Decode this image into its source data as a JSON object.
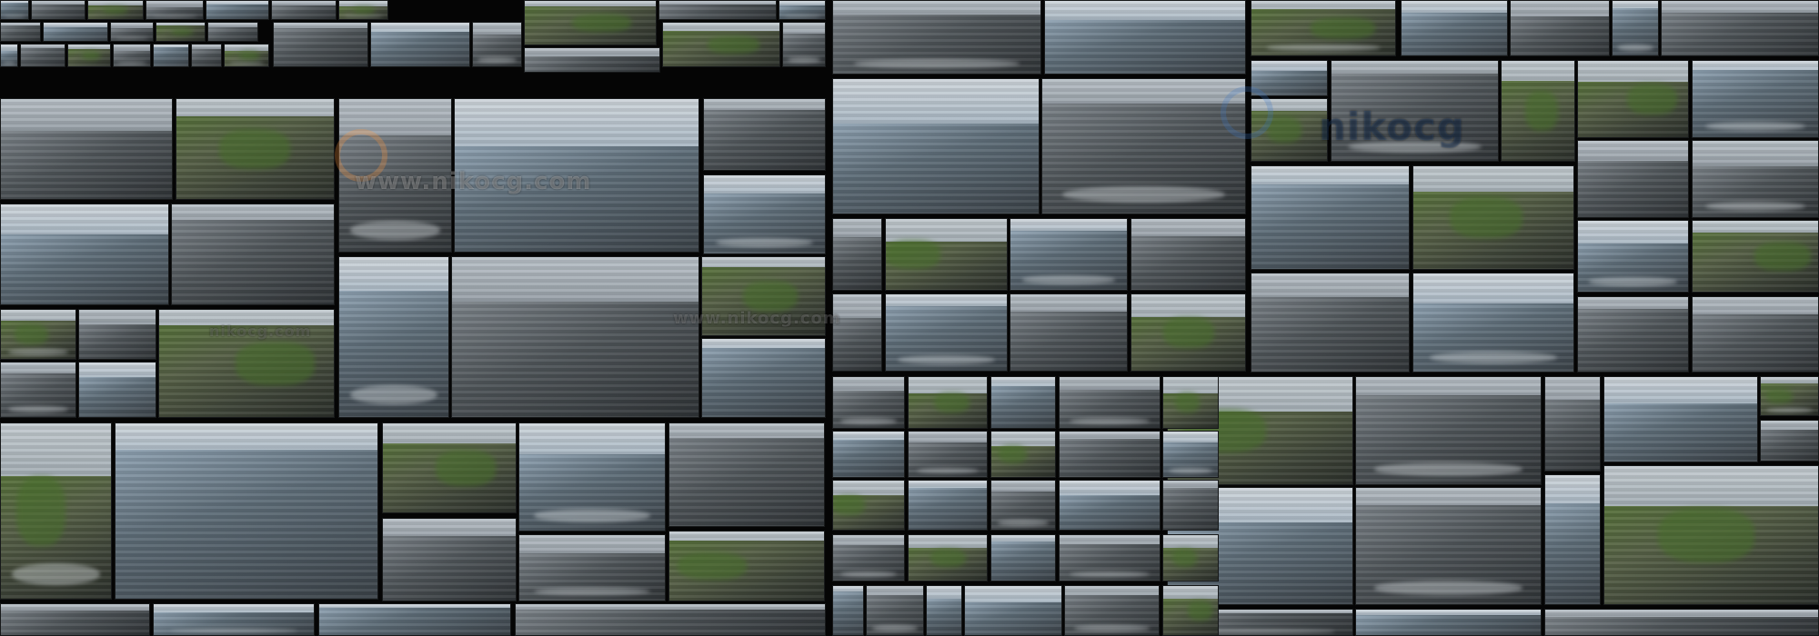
{
  "image": {
    "subject": "collage-grid",
    "dominant_colors": [
      "#050505",
      "#8d969d",
      "#aeb8c4",
      "#3f5f2e",
      "#d9e1e8"
    ],
    "watermark_text": "www.nikocg.com",
    "watermark_text_short": "nikocg.com",
    "watermark_text_large": "nikocg"
  }
}
